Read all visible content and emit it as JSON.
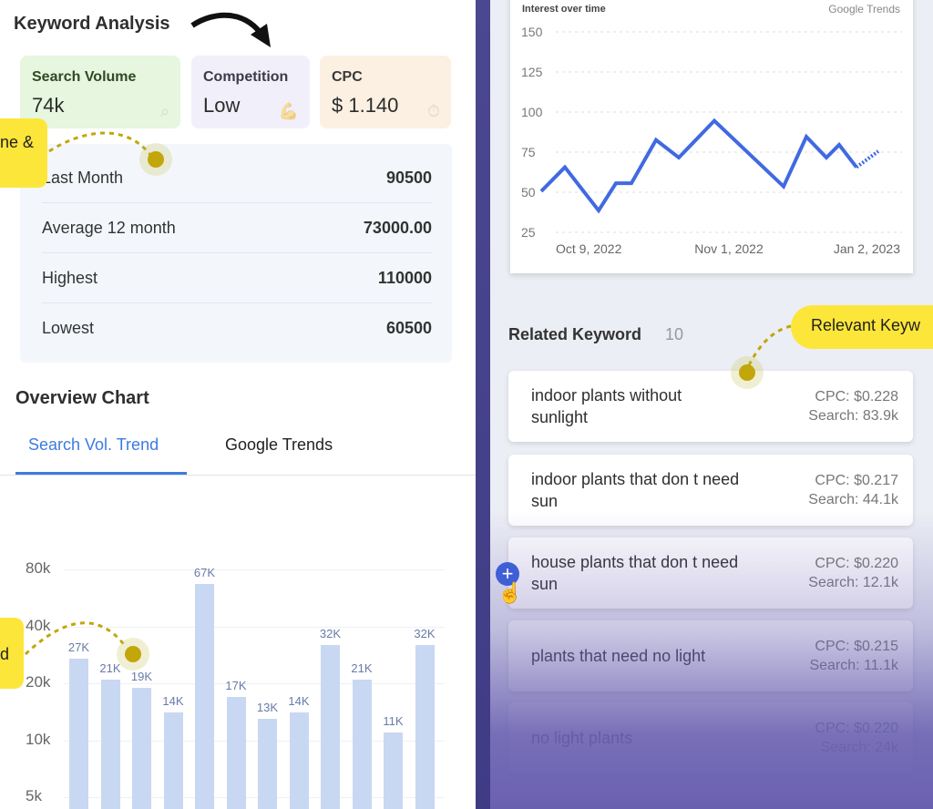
{
  "header": {
    "title": "Keyword Analysis"
  },
  "cards": [
    {
      "label": "Search Volume",
      "value": "74k",
      "icon": "search-icon",
      "bg": "#e6f6df",
      "label_color": "#2e4a25"
    },
    {
      "label": "Competition",
      "value": "Low",
      "icon": "muscle-arm-icon",
      "bg": "#f1eff9",
      "label_color": "#3a3a4a"
    },
    {
      "label": "CPC",
      "value": "$ 1.140",
      "icon": "dollar-stopwatch-icon",
      "bg": "#fcf0e2",
      "label_color": "#3a3a3a"
    }
  ],
  "stats": [
    {
      "label": "Last Month",
      "value": "90500"
    },
    {
      "label": "Average 12 month",
      "value": "73000.00"
    },
    {
      "label": "Highest",
      "value": "110000"
    },
    {
      "label": "Lowest",
      "value": "60500"
    }
  ],
  "overview": {
    "title": "Overview Chart",
    "tabs": [
      {
        "label": "Search Vol. Trend",
        "active": true
      },
      {
        "label": "Google Trends",
        "active": false
      }
    ]
  },
  "callouts": {
    "left_top": "ne &",
    "left_bottom": "d",
    "right": "Relevant Keyw"
  },
  "related": {
    "title": "Related Keyword",
    "count": "10",
    "items": [
      {
        "keyword": "indoor plants without sunlight",
        "cpc": "CPC: $0.228",
        "search": "Search: 83.9k"
      },
      {
        "keyword": "indoor plants that don t need sun",
        "cpc": "CPC: $0.217",
        "search": "Search: 44.1k"
      },
      {
        "keyword": "house plants that don t need sun",
        "cpc": "CPC: $0.220",
        "search": "Search: 12.1k"
      },
      {
        "keyword": "plants that need no light",
        "cpc": "CPC: $0.215",
        "search": "Search: 11.1k"
      },
      {
        "keyword": "no light plants",
        "cpc": "CPC: $0.220",
        "search": "Search: 24k"
      }
    ]
  },
  "chart_data": [
    {
      "type": "bar",
      "yscale": "log",
      "yticks": [
        "80k",
        "40k",
        "20k",
        "10k",
        "5k"
      ],
      "ytick_values": [
        80000,
        40000,
        20000,
        10000,
        5000
      ],
      "values": [
        27000,
        21000,
        19000,
        14000,
        67000,
        17000,
        13000,
        14000,
        32000,
        21000,
        11000,
        32000
      ],
      "labels": [
        "27K",
        "21K",
        "19K",
        "14K",
        "67K",
        "17K",
        "13K",
        "14K",
        "32K",
        "21K",
        "11K",
        "32K"
      ],
      "color": "#c9d8f2",
      "grid": true
    },
    {
      "type": "line",
      "title": "Interest over time",
      "brand": "Google Trends",
      "ylim": [
        25,
        150
      ],
      "yticks": [
        "150",
        "125",
        "100",
        "75",
        "50",
        "25"
      ],
      "xticks": [
        "Oct 9, 2022",
        "Nov 1, 2022",
        "Jan 2, 2023"
      ],
      "values": [
        54,
        69,
        42,
        59,
        59,
        86,
        75,
        98,
        57,
        88,
        75,
        83,
        69
      ],
      "partial_value": 79,
      "color": "#4169e1",
      "grid": true
    }
  ]
}
